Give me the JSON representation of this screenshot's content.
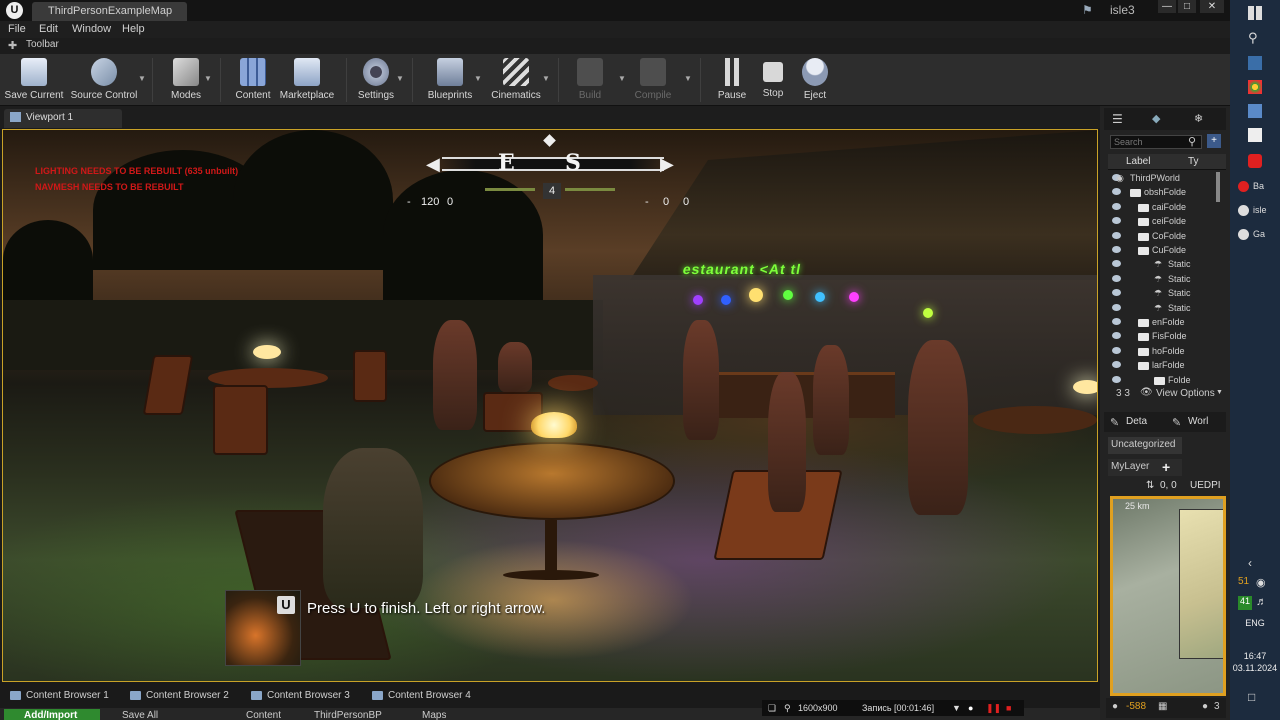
{
  "window": {
    "tab_title": "ThirdPersonExampleMap",
    "project_name": "isle3"
  },
  "menu": {
    "items": [
      "File",
      "Edit",
      "Window",
      "Help"
    ]
  },
  "toolbar_tab": {
    "label": "Toolbar"
  },
  "toolbar": {
    "save_current": "Save Current",
    "source_control": "Source Control",
    "modes": "Modes",
    "content": "Content",
    "marketplace": "Marketplace",
    "settings": "Settings",
    "blueprints": "Blueprints",
    "cinematics": "Cinematics",
    "build": "Build",
    "compile": "Compile",
    "pause": "Pause",
    "stop": "Stop",
    "eject": "Eject"
  },
  "viewport": {
    "tab_label": "Viewport 1",
    "warning_lighting": "LIGHTING NEEDS TO BE REBUILT (635 unbuilt)",
    "warning_navmesh": "NAVMESH NEEDS TO BE REBUILT",
    "sign_text": "estaurant <At tl",
    "compass": {
      "left": "E",
      "center": "S",
      "level": "4",
      "left_num": "120",
      "left_num2": "0",
      "right_num": "0",
      "right_num2": "0",
      "left_minus": "-",
      "right_minus": "-"
    },
    "prompt": {
      "key": "U",
      "text": "Press U to finish. Left or right arrow."
    }
  },
  "content_browser_tabs": [
    "Content Browser 1",
    "Content Browser 2",
    "Content Browser 3",
    "Content Browser 4"
  ],
  "content_browser_bar": {
    "add_import": "Add/Import",
    "save_all": "Save All",
    "path_content": "Content",
    "path_bp": "ThirdPersonBP",
    "path_maps": "Maps"
  },
  "recorder": {
    "resolution": "1600x900",
    "record_label": "Запись [00:01:46]"
  },
  "outliner": {
    "search_placeholder": "Search",
    "col_label": "Label",
    "col_type": "Ty",
    "rows": [
      {
        "label": "ThirdPWorld",
        "indent": 22,
        "kind": "world"
      },
      {
        "label": "obshFolde",
        "indent": 36,
        "kind": "folder"
      },
      {
        "label": "caiFolde",
        "indent": 44,
        "kind": "folder"
      },
      {
        "label": "ceiFolde",
        "indent": 44,
        "kind": "folder"
      },
      {
        "label": "CoFolde",
        "indent": 44,
        "kind": "folder"
      },
      {
        "label": "CuFolde",
        "indent": 44,
        "kind": "folder"
      },
      {
        "label": "Static",
        "indent": 60,
        "kind": "static"
      },
      {
        "label": "Static",
        "indent": 60,
        "kind": "static"
      },
      {
        "label": "Static",
        "indent": 60,
        "kind": "static"
      },
      {
        "label": "Static",
        "indent": 60,
        "kind": "static"
      },
      {
        "label": "enFolde",
        "indent": 44,
        "kind": "folder"
      },
      {
        "label": "FisFolde",
        "indent": 44,
        "kind": "folder"
      },
      {
        "label": "hoFolde",
        "indent": 44,
        "kind": "folder"
      },
      {
        "label": "larFolde",
        "indent": 44,
        "kind": "folder"
      },
      {
        "label": "Folde",
        "indent": 60,
        "kind": "folder"
      }
    ],
    "count": "3 3",
    "view_options": "View Options"
  },
  "details": {
    "tab_details": "Deta",
    "tab_world": "Worl"
  },
  "layers": {
    "uncategorized": "Uncategorized",
    "my_layer": "MyLayer",
    "add": "+"
  },
  "world_comp": {
    "coords": "0, 0",
    "label": "UEDPI",
    "scale": "25 km",
    "bottom_value": "-588",
    "bottom_num": "3"
  },
  "taskbar": {
    "apps": [
      {
        "label": "Ba",
        "color": "#e02020"
      },
      {
        "label": "isle",
        "color": "#dddddd"
      },
      {
        "label": "Ga",
        "color": "#dddddd"
      }
    ],
    "num1": "51",
    "num2": "41",
    "lang": "ENG",
    "time": "16:47",
    "date": "03.11.2024"
  },
  "colors": {
    "accent_green": "#7dff3a",
    "warning_red": "#d01818",
    "minimap_border": "#e0a020",
    "ui_bg": "#2d2d2d"
  }
}
